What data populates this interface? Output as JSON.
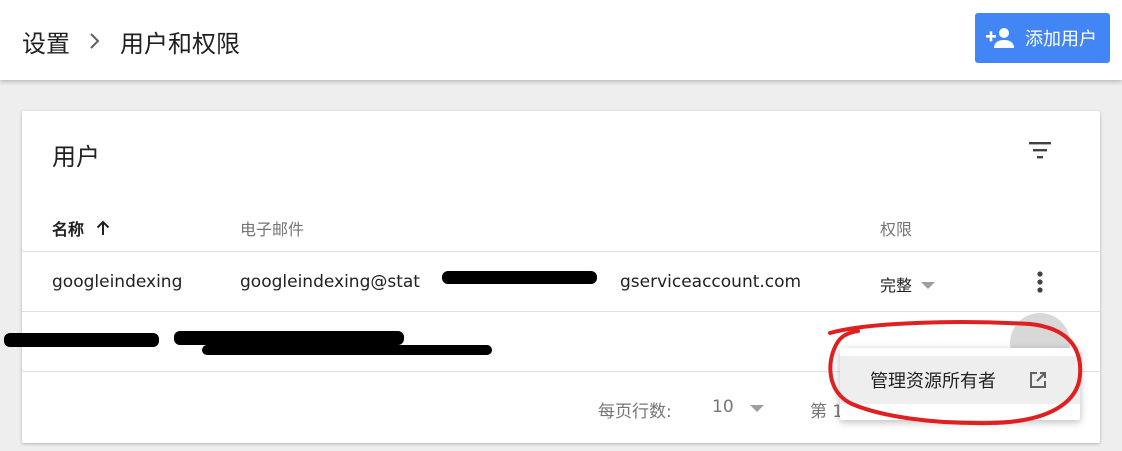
{
  "header": {
    "breadcrumb": [
      "设置",
      "用户和权限"
    ],
    "add_user_label": "添加用户"
  },
  "users_card": {
    "title": "用户",
    "columns": {
      "name": "名称",
      "email": "电子邮件",
      "permission": "权限"
    },
    "rows": [
      {
        "name": "googleindexing",
        "email_prefix": "googleindexing@stat",
        "email_suffix": "gserviceaccount.com",
        "permission": "完整"
      }
    ],
    "footer": {
      "rows_per_page_label": "每页行数:",
      "rows_per_page_value": "10",
      "page_label": "第 1"
    }
  },
  "context_menu": {
    "item_label": "管理资源所有者"
  },
  "colors": {
    "accent": "#4285f4",
    "annotation": "#e02020"
  },
  "icons": {
    "breadcrumb_separator": "chevron-right-icon",
    "add_user": "person-add-icon",
    "filter": "filter-icon",
    "sort": "arrow-up-icon",
    "row_menu": "more-vert-icon",
    "menu_item": "open-in-new-icon"
  }
}
